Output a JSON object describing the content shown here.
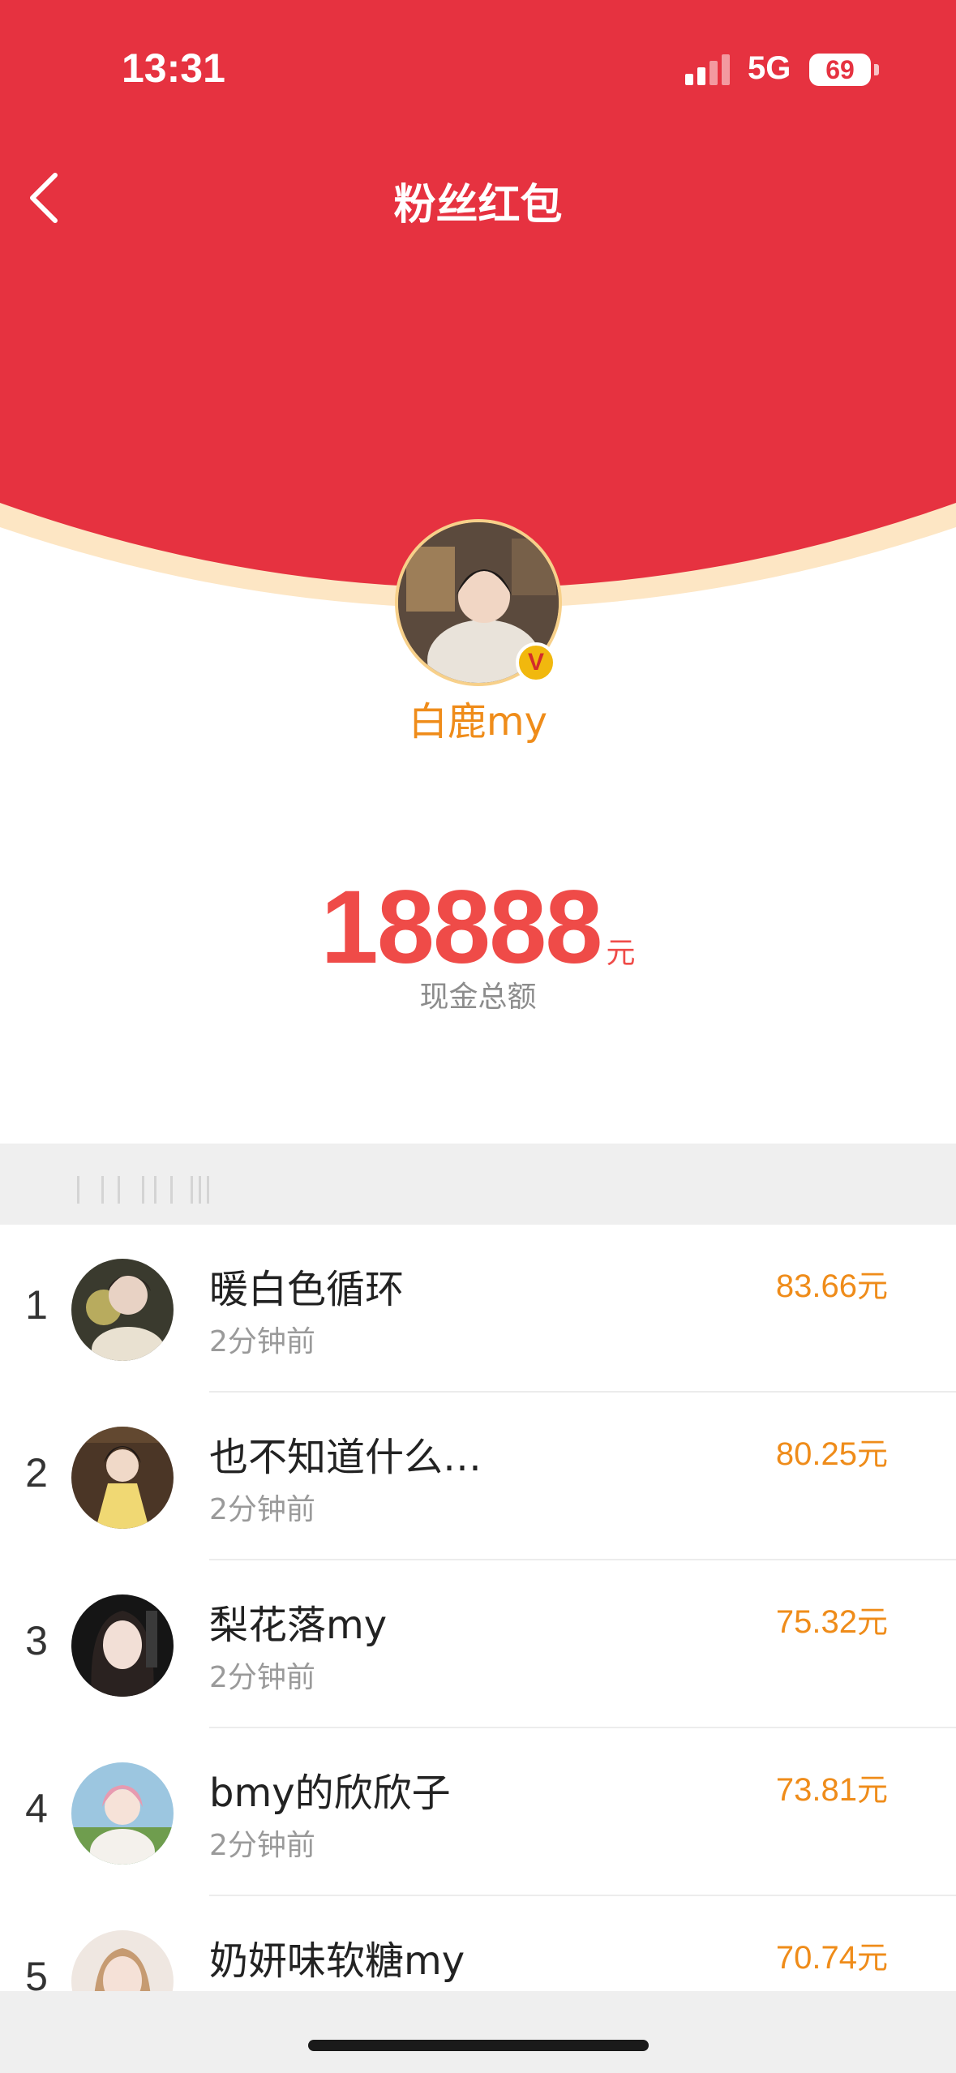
{
  "status_bar": {
    "time": "13:31",
    "network": "5G",
    "battery": "69"
  },
  "nav": {
    "title": "粉丝红包"
  },
  "header_colors": {
    "primary": "#e63240",
    "rim": "#fde6c4"
  },
  "sender": {
    "name": "白鹿my",
    "verified_badge": "V"
  },
  "total": {
    "amount": "18888",
    "unit": "元",
    "label": "现金总额"
  },
  "list": {
    "items": [
      {
        "rank": "1",
        "name": "暖白色循环",
        "time": "2分钟前",
        "amount": "83.66",
        "unit": "元"
      },
      {
        "rank": "2",
        "name": "也不知道什么…",
        "time": "2分钟前",
        "amount": "80.25",
        "unit": "元"
      },
      {
        "rank": "3",
        "name": "梨花落my",
        "time": "2分钟前",
        "amount": "75.32",
        "unit": "元"
      },
      {
        "rank": "4",
        "name": "bmy的欣欣子",
        "time": "2分钟前",
        "amount": "73.81",
        "unit": "元"
      },
      {
        "rank": "5",
        "name": "奶妍味软糖my",
        "time": "",
        "amount": "70.74",
        "unit": "元"
      }
    ]
  }
}
